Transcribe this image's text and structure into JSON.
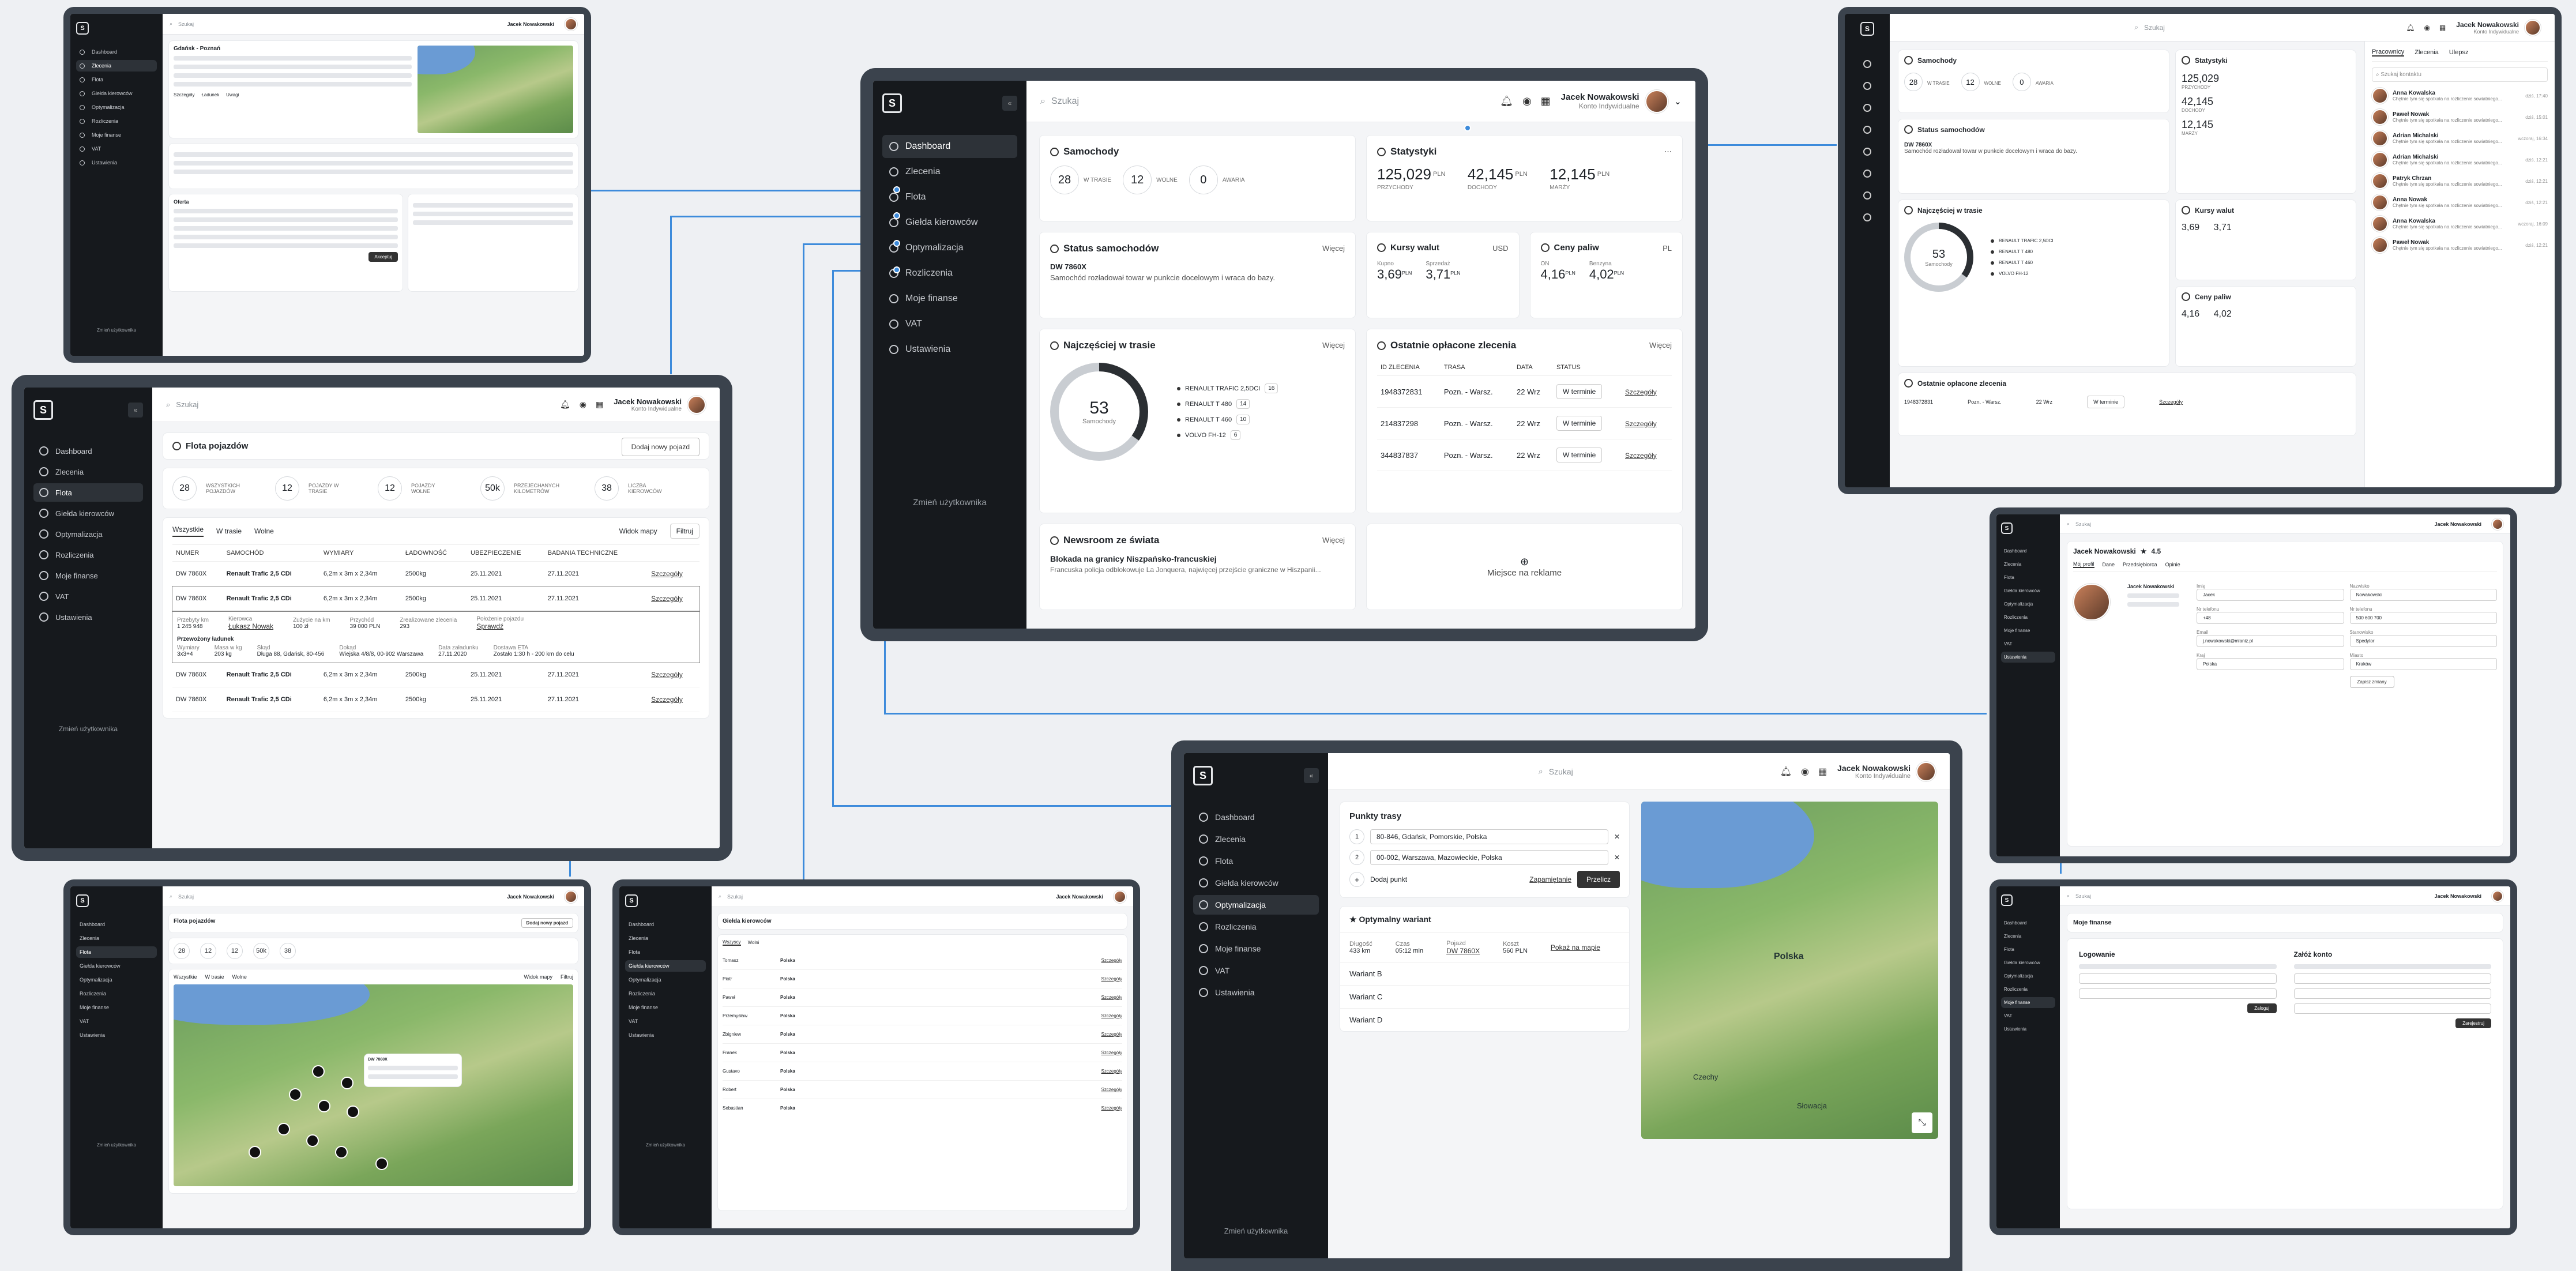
{
  "app": {
    "user_name": "Jacek Nowakowski",
    "user_role": "Konto Indywidualne",
    "search_placeholder": "Szukaj",
    "nav": [
      "Dashboard",
      "Zlecenia",
      "Flota",
      "Giełda kierowców",
      "Optymalizacja",
      "Rozliczenia",
      "Moje finanse",
      "VAT",
      "Ustawienia"
    ],
    "change_user": "Zmień użytkownika"
  },
  "dashboard": {
    "cars_title": "Samochody",
    "cars": [
      {
        "n": "28",
        "label": "W TRASIE"
      },
      {
        "n": "12",
        "label": "WOLNE"
      },
      {
        "n": "0",
        "label": "AWARIA"
      }
    ],
    "stats_title": "Statystyki",
    "stats": [
      {
        "v": "125,029",
        "u": "PLN",
        "l": "PRZYCHODY"
      },
      {
        "v": "42,145",
        "u": "PLN",
        "l": "DOCHODY"
      },
      {
        "v": "12,145",
        "u": "PLN",
        "l": "MARŻY"
      }
    ],
    "status_title": "Status samochodów",
    "more": "Więcej",
    "status_plate": "DW 7860X",
    "status_text": "Samochód rozładował towar w punkcie docelowym i wraca do bazy.",
    "rates_title": "Kursy walut",
    "rates_cur": "USD",
    "buy_label": "Kupno",
    "buy": "3,69",
    "sell_label": "Sprzedaż",
    "sell": "3,71",
    "fuel_title": "Ceny paliw",
    "fuel_cur": "PL",
    "on_label": "ON",
    "on": "4,16",
    "pb_label": "Benzyna",
    "pb": "4,02",
    "pln": "PLN",
    "route_title": "Najczęściej w trasie",
    "donut_n": "53",
    "donut_l": "Samochody",
    "route_items": [
      {
        "n": "RENAULT TRAFIC 2,5DCI",
        "v": "16"
      },
      {
        "n": "RENAULT T 480",
        "v": "14"
      },
      {
        "n": "RENAULT T 460",
        "v": "10"
      },
      {
        "n": "VOLVO FH-12",
        "v": "6"
      }
    ],
    "orders_title": "Ostatnie opłacone zlecenia",
    "orders_cols": [
      "ID ZLECENIA",
      "TRASA",
      "DATA",
      "STATUS"
    ],
    "orders": [
      {
        "id": "1948372831",
        "trasa": "Pozn. - Warsz.",
        "data": "22 Wrz",
        "status": "W terminie",
        "link": "Szczegóły"
      },
      {
        "id": "214837298",
        "trasa": "Pozn. - Warsz.",
        "data": "22 Wrz",
        "status": "W terminie",
        "link": "Szczegóły"
      },
      {
        "id": "344837837",
        "trasa": "Pozn. - Warsz.",
        "data": "22 Wrz",
        "status": "W terminie",
        "link": "Szczegóły"
      }
    ],
    "news_title": "Newsroom ze świata",
    "news_head": "Blokada na granicy Niszpańsko-francuskiej",
    "news_text": "Francuska policja odblokowuje La Jonquera, najwięcej przejście graniczne w Hiszpanii...",
    "ad": "Miejsce na reklame"
  },
  "fleet": {
    "title": "Flota pojazdów",
    "add": "Dodaj nowy pojazd",
    "stats": [
      {
        "n": "28",
        "l": "WSZYSTKICH POJAZDÓW"
      },
      {
        "n": "12",
        "l": "POJAZDY W TRASIE"
      },
      {
        "n": "12",
        "l": "POJAZDY WOLNE"
      },
      {
        "n": "50k",
        "l": "PRZEJECHANYCH KILOMETRÓW"
      },
      {
        "n": "38",
        "l": "LICZBA KIEROWCÓW"
      }
    ],
    "tabs": [
      "Wszystkie",
      "W trasie",
      "Wolne"
    ],
    "map_view": "Widok mapy",
    "filter": "Filtruj",
    "cols": [
      "NUMER",
      "SAMOCHÓD",
      "WYMIARY",
      "ŁADOWNOŚĆ",
      "UBEZPIECZENIE",
      "BADANIA TECHNICZNE"
    ],
    "rows": [
      {
        "nr": "DW 7860X",
        "car": "Renault Trafic 2,5 CDi",
        "dim": "6,2m x 3m x 2,34m",
        "load": "2500kg",
        "ins": "25.11.2021",
        "tech": "27.11.2021",
        "link": "Szczegóły"
      },
      {
        "nr": "DW 7860X",
        "car": "Renault Trafic 2,5 CDi",
        "dim": "6,2m x 3m x 2,34m",
        "load": "2500kg",
        "ins": "25.11.2021",
        "tech": "27.11.2021",
        "link": "Szczegóły"
      },
      {
        "nr": "DW 7860X",
        "car": "Renault Trafic 2,5 CDi",
        "dim": "6,2m x 3m x 2,34m",
        "load": "2500kg",
        "ins": "25.11.2021",
        "tech": "27.11.2021",
        "link": "Szczegóły"
      },
      {
        "nr": "DW 7860X",
        "car": "Renault Trafic 2,5 CDi",
        "dim": "6,2m x 3m x 2,34m",
        "load": "2500kg",
        "ins": "25.11.2021",
        "tech": "27.11.2021",
        "link": "Szczegóły"
      },
      {
        "nr": "DW 7860X",
        "car": "Renault Trafic 2,5 CDi",
        "dim": "6,2m x 3m x 2,34m",
        "load": "2500kg",
        "ins": "25.11.2021",
        "tech": "27.11.2021",
        "link": "Szczegóły"
      },
      {
        "nr": "DW 7860X",
        "car": "Renault Trafic 2,5 CDi",
        "dim": "6,2m x 3m x 2,34m",
        "load": "2500kg",
        "ins": "25.11.2021",
        "tech": "27.11.2021",
        "link": "Szczegóły"
      }
    ],
    "detail": {
      "f1l": "Przebyty km",
      "f1": "1 245 948",
      "f2l": "Kierowca",
      "f2": "Łukasz Nowak",
      "f3l": "Zużycie na km",
      "f3": "100 zł",
      "f4l": "Przychód",
      "f4": "39 000 PLN",
      "f5l": "Zrealizowane zlecenia",
      "f5": "293",
      "f6l": "Położenie pojazdu",
      "f6": "Sprawdź",
      "cargo": "Przewożony ładunek",
      "c1l": "Wymiary",
      "c1": "3x3+4",
      "c2l": "Masa w kg",
      "c2": "203 kg",
      "c3l": "Skąd",
      "c3": "Długa 88, Gdańsk, 80-456",
      "c4l": "Dokąd",
      "c4": "Wiejska 4/8/8, 00-902 Warszawa",
      "c5l": "Data załadunku",
      "c5": "27.11.2020",
      "c6l": "Dostawa ETA",
      "c6": "Zostało 1:30 h - 200 km do celu"
    }
  },
  "optim": {
    "title": "Punkty trasy",
    "p1": "80-846, Gdańsk, Pomorskie, Polska",
    "p2": "00-002, Warszawa, Mazowieckie, Polska",
    "add": "Dodaj punkt",
    "save": "Zapamiętanie",
    "calc": "Przelicz",
    "best": "Optymalny wariant",
    "b1l": "Długość",
    "b1": "433 km",
    "b2l": "Czas",
    "b2": "05:12 min",
    "b3l": "Pojazd",
    "b3": "DW 7860X",
    "b4l": "Koszt",
    "b4": "560 PLN",
    "show": "Pokaż na mapie",
    "variants": [
      "Wariant B",
      "Wariant C",
      "Wariant D"
    ],
    "map_country": "Polska",
    "map_label2": "Czechy",
    "map_label3": "Słowacja"
  },
  "messages": {
    "tabs": [
      "Pracownicy",
      "Zlecenia",
      "Ulepsz"
    ],
    "search": "Szukaj kontaktu",
    "items": [
      {
        "n": "Anna Kowalska",
        "m": "Chętnie tym się spotkała na rozliczenie sowiatniego...",
        "t": "dziś, 17:40"
      },
      {
        "n": "Paweł Nowak",
        "m": "Chętnie tym się spotkała na rozliczenie sowiatniego...",
        "t": "dziś, 15:01"
      },
      {
        "n": "Adrian Michalski",
        "m": "Chętnie tym się spotkała na rozliczenie sowiatniego...",
        "t": "wczoraj, 16:34"
      },
      {
        "n": "Adrian Michalski",
        "m": "Chętnie tym się spotkała na rozliczenie sowiatniego...",
        "t": "dziś, 12:21"
      },
      {
        "n": "Patryk Chrzan",
        "m": "Chętnie tym się spotkała na rozliczenie sowiatniego...",
        "t": "dziś, 12:21"
      },
      {
        "n": "Anna Nowak",
        "m": "Chętnie tym się spotkała na rozliczenie sowiatniego...",
        "t": "dziś, 12:21"
      },
      {
        "n": "Anna Kowalska",
        "m": "Chętnie tym się spotkała na rozliczenie sowiatniego...",
        "t": "wczoraj, 16:09"
      },
      {
        "n": "Paweł Nowak",
        "m": "Chętnie tym się spotkała na rozliczenie sowiatniego...",
        "t": "dziś, 12:21"
      }
    ]
  },
  "profile": {
    "name": "Jacek Nowakowski",
    "rating": "4.5",
    "tabs": [
      "Mój profil",
      "Dane",
      "Przedsiębiorca",
      "Opinie"
    ],
    "fields": [
      {
        "l": "Imię",
        "v": "Jacek"
      },
      {
        "l": "Nazwisko",
        "v": "Nowakowski"
      },
      {
        "l": "Nr telefonu",
        "v": "+48"
      },
      {
        "l": "Nr telefonu",
        "v": "500 600 700"
      },
      {
        "l": "Email",
        "v": "j.nowakowski@mlaniz.pl"
      },
      {
        "l": "Stanowisko",
        "v": "Spedytor"
      },
      {
        "l": "Kraj",
        "v": "Polska"
      },
      {
        "l": "Miasto",
        "v": "Kraków"
      }
    ],
    "save": "Zapisz zmiany"
  },
  "finance": {
    "title": "Moje finanse",
    "login": "Logowanie",
    "register": "Załóż konto",
    "login_btn": "Zaloguj",
    "register_btn": "Zarejestruj"
  },
  "drivers": {
    "title": "Giełda kierowców",
    "tabs": [
      "Wszyscy",
      "Wolni"
    ],
    "names": [
      "Tomasz",
      "Piotr",
      "Paweł",
      "Przemysław",
      "Zbigniew",
      "Franek",
      "Gustavo",
      "Robert",
      "Sebastian"
    ],
    "country": "Polska",
    "link": "Szczegóły"
  },
  "orders_screen": {
    "route": "Gdańsk - Poznań",
    "tabs": [
      "Szczegóły",
      "Ładunek",
      "Uwagi"
    ],
    "offers": "Oferta",
    "accept": "Akceptuj"
  }
}
